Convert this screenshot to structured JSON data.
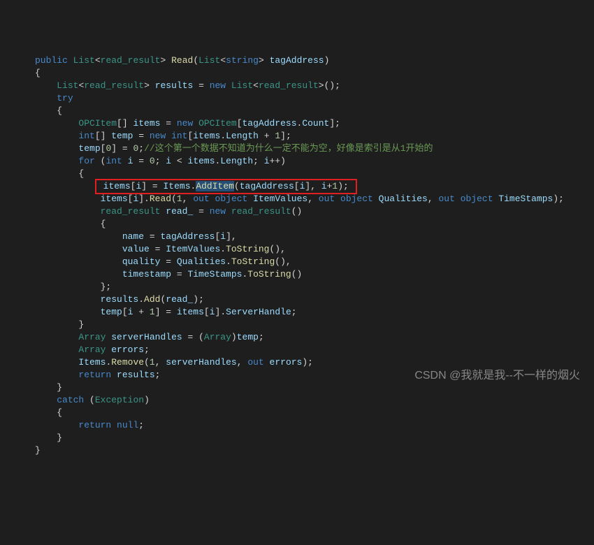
{
  "code": {
    "l01a": "public",
    "l01b": "List",
    "l01c": "read_result",
    "l01d": "Read",
    "l01e": "List",
    "l01f": "string",
    "l01g": "tagAddress",
    "l02a": "{",
    "l03a": "List",
    "l03b": "read_result",
    "l03c": "results",
    "l03d": "new",
    "l03e": "List",
    "l03f": "read_result",
    "l04a": "try",
    "l05a": "{",
    "l06a": "OPCItem",
    "l06b": "items",
    "l06c": "new",
    "l06d": "OPCItem",
    "l06e": "tagAddress",
    "l06f": "Count",
    "l07a": "int",
    "l07b": "temp",
    "l07c": "new",
    "l07d": "int",
    "l07e": "items",
    "l07f": "Length",
    "l07g": "1",
    "l08a": "temp",
    "l08b": "0",
    "l08c": "0",
    "l08d": "//这个第一个数据不知道为什么一定不能为空，好像是索引是从1开始的",
    "l09a": "for",
    "l09b": "int",
    "l09c": "i",
    "l09d": "0",
    "l09e": "i",
    "l09f": "items",
    "l09g": "Length",
    "l09h": "i",
    "l10a": "{",
    "l11a": "items",
    "l11b": "i",
    "l11c": "Items",
    "l11d": "AddItem",
    "l11e": "tagAddress",
    "l11f": "i",
    "l11g": "i",
    "l11h": "1",
    "l12a": "items",
    "l12b": "i",
    "l12c": "Read",
    "l12d": "1",
    "l12e": "out",
    "l12f": "object",
    "l12g": "ItemValues",
    "l12h": "out",
    "l12i": "object",
    "l12j": "Qualities",
    "l12k": "out",
    "l12l": "object",
    "l12m": "TimeStamps",
    "l13a": "read_result",
    "l13b": "read_",
    "l13c": "new",
    "l13d": "read_result",
    "l14a": "{",
    "l15a": "name",
    "l15b": "tagAddress",
    "l15c": "i",
    "l16a": "value",
    "l16b": "ItemValues",
    "l16c": "ToString",
    "l17a": "quality",
    "l17b": "Qualities",
    "l17c": "ToString",
    "l18a": "timestamp",
    "l18b": "TimeStamps",
    "l18c": "ToString",
    "l19a": "};",
    "l20a": "results",
    "l20b": "Add",
    "l20c": "read_",
    "l21a": "temp",
    "l21b": "i",
    "l21c": "1",
    "l21d": "items",
    "l21e": "i",
    "l21f": "ServerHandle",
    "l22a": "}",
    "l23a": "Array",
    "l23b": "serverHandles",
    "l23c": "Array",
    "l23d": "temp",
    "l24a": "Array",
    "l24b": "errors",
    "l25a": "Items",
    "l25b": "Remove",
    "l25c": "1",
    "l25d": "serverHandles",
    "l25e": "out",
    "l25f": "errors",
    "l26a": "return",
    "l26b": "results",
    "l27a": "}",
    "l28a": "catch",
    "l28b": "Exception",
    "l29a": "{",
    "l30a": "return",
    "l30b": "null",
    "l31a": "}",
    "l32a": "}"
  },
  "watermark": "CSDN @我就是我--不一样的烟火"
}
